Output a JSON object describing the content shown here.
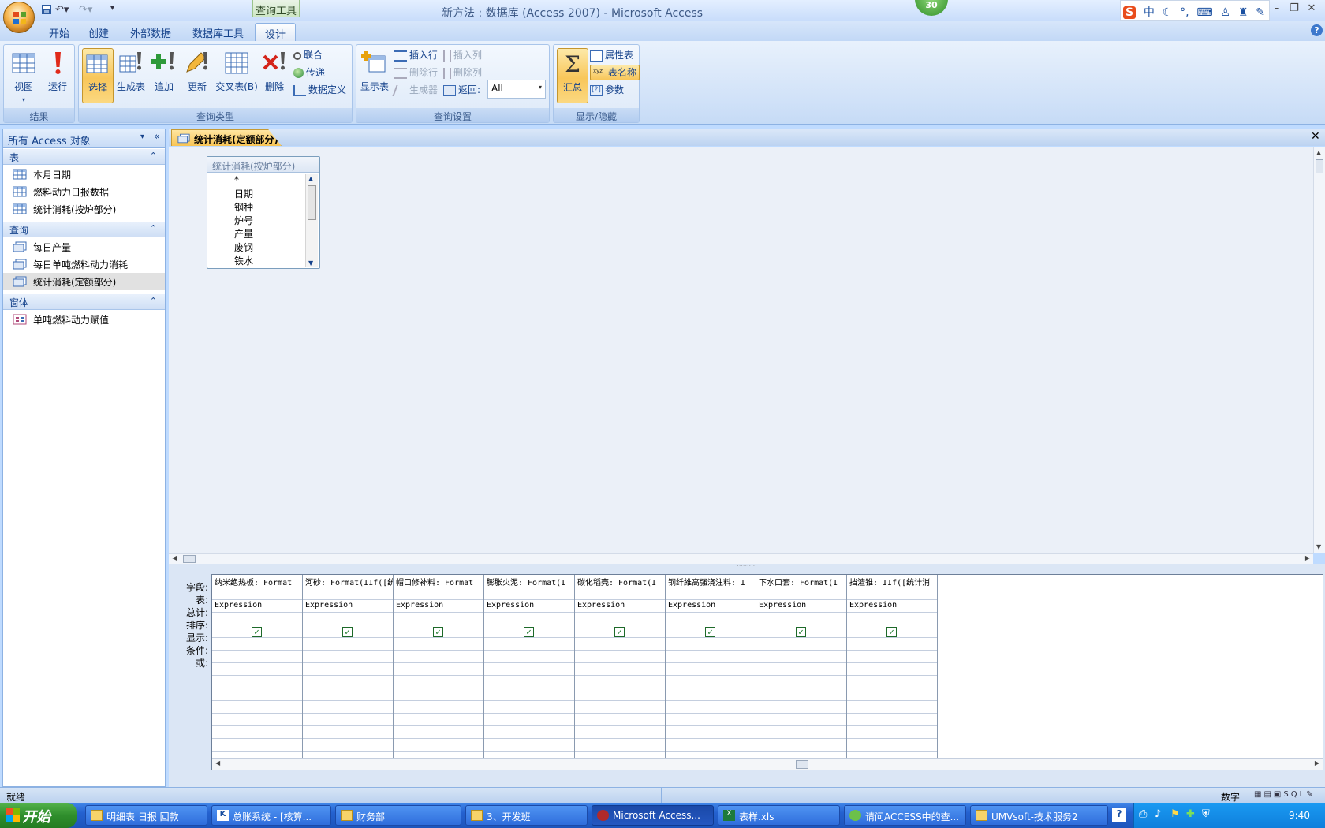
{
  "window": {
    "title": "新方法 : 数据库 (Access 2007) - Microsoft Access",
    "contextual_tab": "查询工具",
    "notification_badge": "30",
    "ime_indicator": "中"
  },
  "ribbon_tabs": [
    "开始",
    "创建",
    "外部数据",
    "数据库工具",
    "设计"
  ],
  "active_tab": "设计",
  "ribbon": {
    "results": {
      "label": "结果",
      "view": "视图",
      "run": "运行"
    },
    "query_type": {
      "label": "查询类型",
      "select": "选择",
      "make_table": "生成表",
      "append": "追加",
      "update": "更新",
      "crosstab": "交叉表(B)",
      "delete": "删除",
      "union": "联合",
      "pass_through": "传递",
      "data_definition": "数据定义"
    },
    "query_setup": {
      "label": "查询设置",
      "show_table": "显示表",
      "insert_rows": "插入行",
      "delete_rows": "删除行",
      "builder": "生成器",
      "insert_columns": "插入列",
      "delete_columns": "删除列",
      "return_label": "返回:",
      "return_value": "All"
    },
    "show_hide": {
      "label": "显示/隐藏",
      "totals": "汇总",
      "property_sheet": "属性表",
      "table_names": "表名称",
      "parameters": "参数"
    }
  },
  "nav_pane": {
    "header": "所有 Access 对象",
    "sections": [
      {
        "title": "表",
        "items": [
          "本月日期",
          "燃料动力日报数据",
          "统计消耗(按炉部分)"
        ]
      },
      {
        "title": "查询",
        "items": [
          "每日产量",
          "每日单吨燃料动力消耗",
          "统计消耗(定额部分)"
        ]
      },
      {
        "title": "窗体",
        "items": [
          "单吨燃料动力赋值"
        ]
      }
    ],
    "selected_item": "统计消耗(定额部分)"
  },
  "document": {
    "tab_title": "统计消耗(定额部分)",
    "field_list": {
      "title": "统计消耗(按炉部分)",
      "fields": [
        "*",
        "日期",
        "钢种",
        "炉号",
        "产量",
        "废钢",
        "铁水"
      ]
    },
    "grid": {
      "row_labels": [
        "字段:",
        "表:",
        "总计:",
        "排序:",
        "显示:",
        "条件:",
        "或:"
      ],
      "columns": [
        {
          "field": "纳米绝热板: Format",
          "total": "Expression",
          "show": true
        },
        {
          "field": "河砂: Format(IIf([统",
          "total": "Expression",
          "show": true
        },
        {
          "field": "帽口修补料: Format",
          "total": "Expression",
          "show": true
        },
        {
          "field": "膨胀火泥: Format(I",
          "total": "Expression",
          "show": true
        },
        {
          "field": "碳化稻壳: Format(I",
          "total": "Expression",
          "show": true
        },
        {
          "field": "钢纤維高强浇注料: I",
          "total": "Expression",
          "show": true
        },
        {
          "field": "下水口套: Format(I",
          "total": "Expression",
          "show": true
        },
        {
          "field": "挡渣锥: IIf([统计消",
          "total": "Expression",
          "show": true
        }
      ]
    }
  },
  "status_bar": {
    "left": "就绪",
    "mode": "数字"
  },
  "taskbar": {
    "start": "开始",
    "tasks": [
      "明细表 日报 回款",
      "总账系统 - [核算...",
      "财务部",
      "3、开发班",
      "Microsoft Access...",
      "表样.xls",
      "请问ACCESS中的查...",
      "UMVsoft-技术服务2"
    ],
    "active_task": "Microsoft Access...",
    "clock": "9:40"
  },
  "colors": {
    "ribbon_bg": "#d1e2f8",
    "selected_button": "#f8c65a",
    "accent_blue": "#15428b",
    "taskbar": "#2461cf",
    "start_green": "#2f8e2c"
  }
}
